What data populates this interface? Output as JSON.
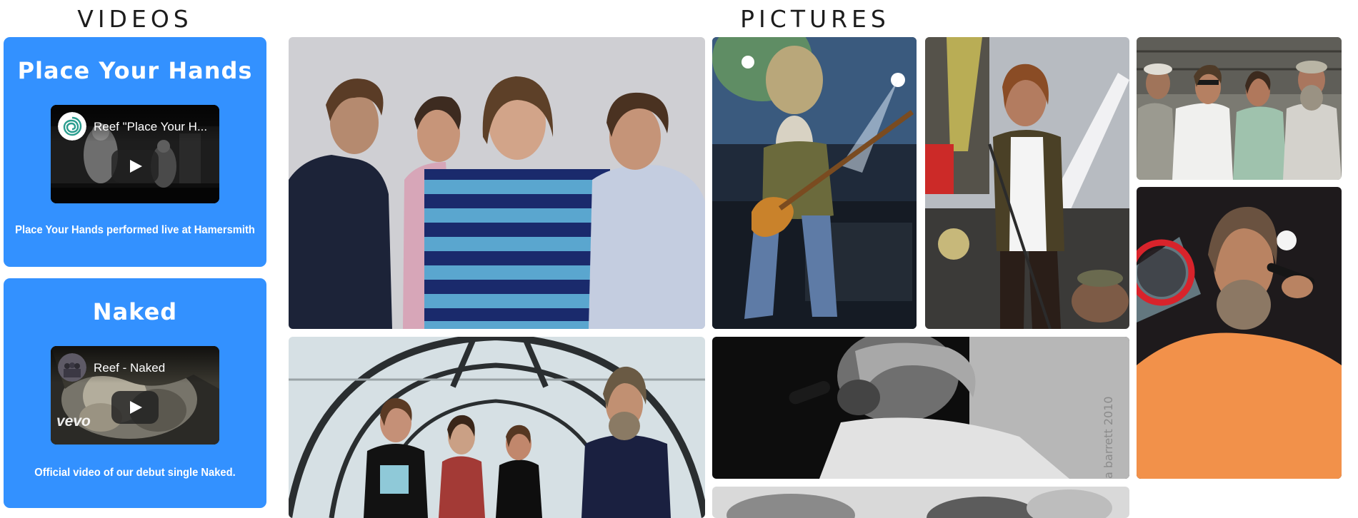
{
  "sections": {
    "videos_title": "VIDEOS",
    "pictures_title": "PICTURES"
  },
  "videos": [
    {
      "title": "Place Your Hands",
      "embed_title": "Reef \"Place Your H...",
      "caption": "Place Your Hands performed live at Hamersmith"
    },
    {
      "title": "Naked",
      "embed_title": "Reef - Naked",
      "watermark": "vevo",
      "caption": "Official video of our debut single Naked."
    }
  ],
  "pictures": [
    {
      "name": "band-studio-portrait"
    },
    {
      "name": "bassist-live-stage"
    },
    {
      "name": "singer-live-stage"
    },
    {
      "name": "band-outdoor-portrait"
    },
    {
      "name": "singer-with-tambourine"
    },
    {
      "name": "band-in-tunnel"
    },
    {
      "name": "black-and-white-singer",
      "watermark": "a barrett 2010"
    },
    {
      "name": "black-and-white-crowd"
    }
  ],
  "colors": {
    "card_background": "#3391ff",
    "card_text": "#ffffff",
    "heading_text": "#1c1c1c"
  }
}
